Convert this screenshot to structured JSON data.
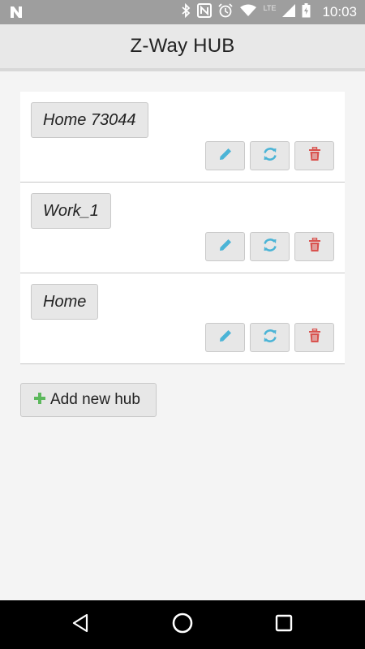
{
  "status_bar": {
    "time": "10:03",
    "network_label": "LTE",
    "icons": [
      "n-logo-icon",
      "bluetooth-icon",
      "nfc-icon",
      "alarm-icon",
      "wifi-icon",
      "signal-icon",
      "battery-icon"
    ]
  },
  "header": {
    "title": "Z-Way HUB"
  },
  "hubs": [
    {
      "name": "Home 73044"
    },
    {
      "name": "Work_1"
    },
    {
      "name": "Home"
    }
  ],
  "actions": {
    "edit_icon": "pencil-icon",
    "refresh_icon": "refresh-icon",
    "delete_icon": "trash-icon"
  },
  "add_button": {
    "label": "Add new hub",
    "icon": "plus-icon"
  },
  "colors": {
    "edit_icon": "#4bb4d6",
    "refresh_icon": "#4bb4d6",
    "delete_icon": "#d9534f",
    "plus_icon": "#5cb85c"
  },
  "nav_bar": {
    "icons": [
      "back-icon",
      "home-icon",
      "recents-icon"
    ]
  }
}
